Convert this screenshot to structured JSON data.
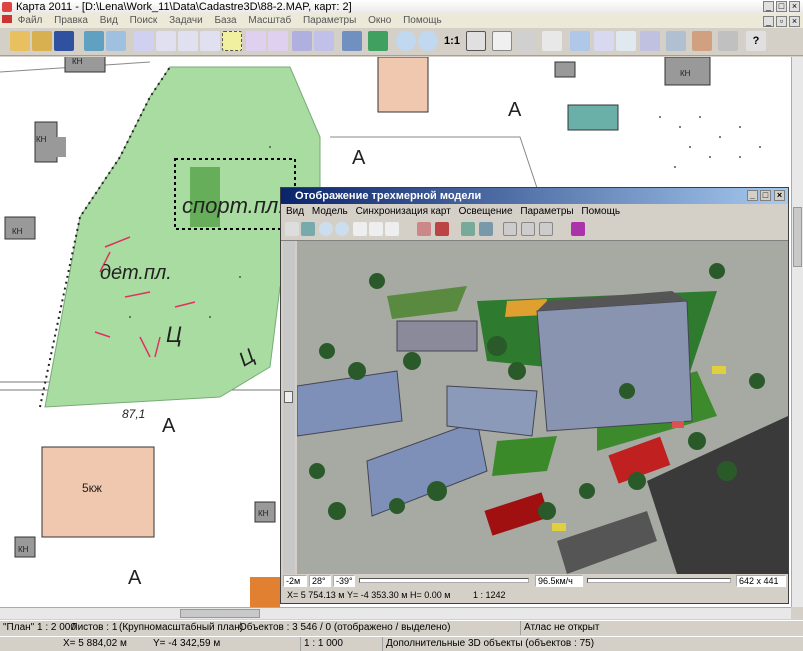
{
  "window": {
    "title": "Карта 2011 - [D:\\Lena\\Work_11\\Data\\Cadastre3D\\88-2.MAP, карт: 2]"
  },
  "menu": [
    "Файл",
    "Правка",
    "Вид",
    "Поиск",
    "Задачи",
    "База",
    "Масштаб",
    "Параметры",
    "Окно",
    "Помощь"
  ],
  "toolbar": {
    "scale_label": "1:1"
  },
  "map": {
    "labels": {
      "sport": "спорт.пл.",
      "det": "дет.пл.",
      "c1": "Ц",
      "c2": "Ц",
      "a1": "А",
      "a2": "А",
      "a3": "А",
      "a4": "А",
      "elev": "87,1",
      "kn1": "КН",
      "kn2": "КН",
      "kn3": "КН",
      "kn4": "КН",
      "kn5": "КН",
      "kn6": "КН",
      "bld": "5кж"
    }
  },
  "viewer3d": {
    "title": "Отображение трехмерной модели",
    "menu": [
      "Вид",
      "Модель",
      "Синхронизация карт",
      "Освещение",
      "Параметры",
      "Помощь"
    ],
    "status": {
      "height": "-2м",
      "angle1": "28°",
      "angle2": "-39°",
      "speed": "96.5км/ч",
      "size": "642 x 441",
      "coords": "X= 5 754.13 м  Y= -4 353.30 м  H= 0.00 м",
      "scale": "1 : 1242"
    }
  },
  "status": {
    "plan": "\"План\"  1 : 2 000",
    "sheets": "Листов : 1",
    "mapname": "(Крупномасштабный план)",
    "objects": "Объектов : 3 546 / 0 (отображено / выделено)",
    "atlas": "Атлас не открыт",
    "x": "X=     5 884,02 м",
    "y": "Y=    -4 342,59 м",
    "scale": "1 : 1 000",
    "extra": "Дополнительные 3D объекты  (объектов : 75)"
  },
  "colors": {
    "park": "#a8dca0",
    "grass": "#4a9a3a",
    "titlebar": "#0a246a"
  }
}
